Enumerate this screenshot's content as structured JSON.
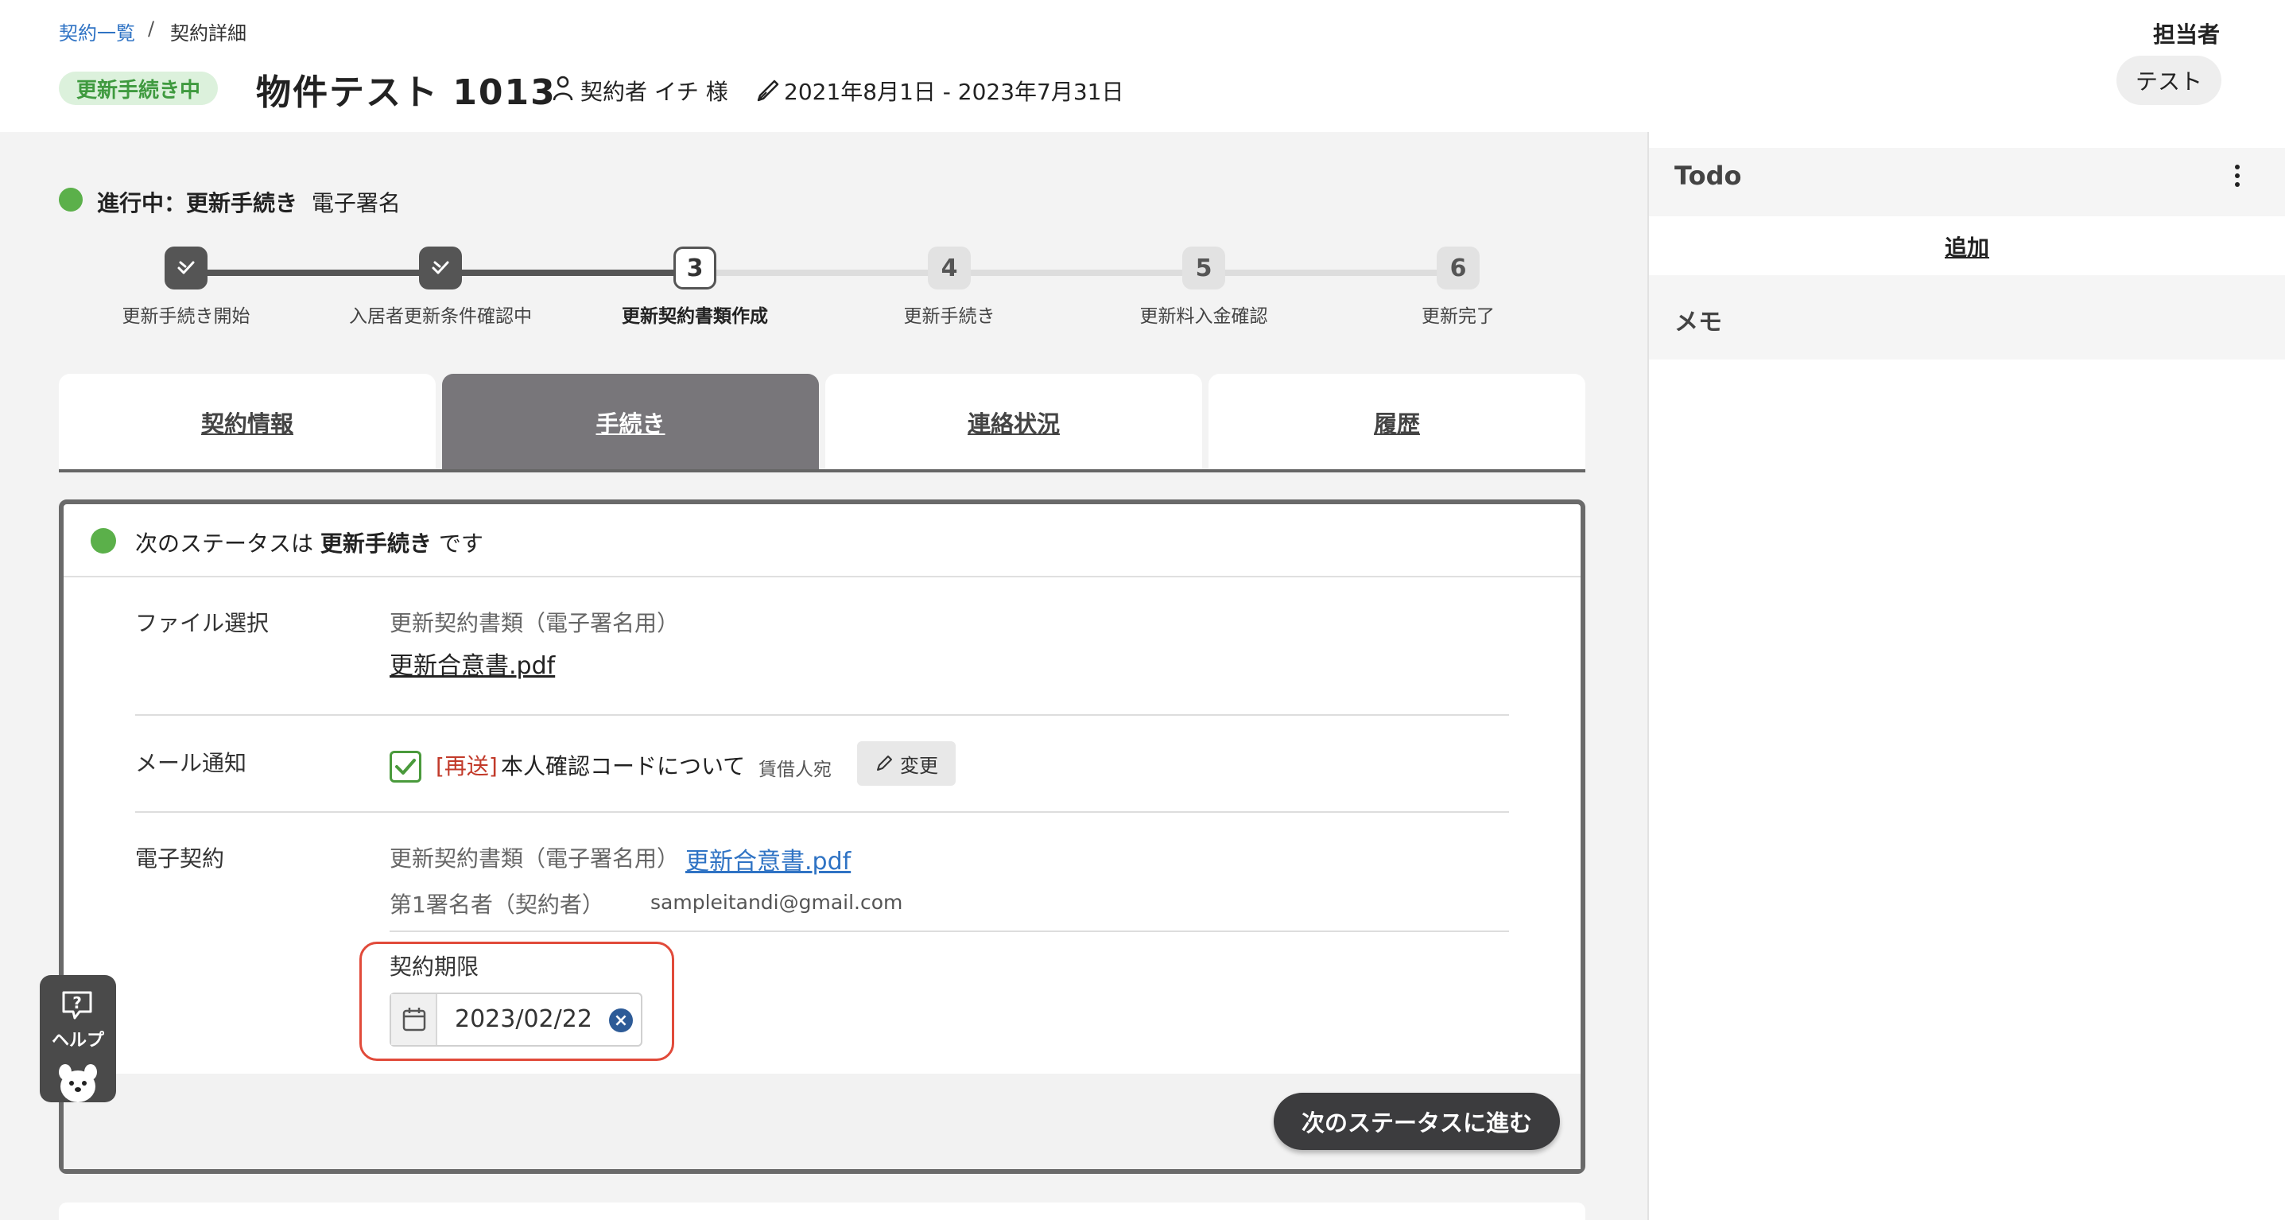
{
  "breadcrumb": {
    "parent": "契約一覧",
    "separator": "/",
    "current": "契約詳細"
  },
  "header": {
    "status_badge": "更新手続き中",
    "title": "物件テスト 1013",
    "contractor": "契約者 イチ 様",
    "period": "2021年8月1日 - 2023年7月31日",
    "assignee_label": "担当者",
    "assignee": "テスト"
  },
  "progress": {
    "prefix": "進行中：更新手続き",
    "detail": "電子署名",
    "status_color": "#5bb04a"
  },
  "steps": [
    {
      "num": "1",
      "label": "更新手続き開始",
      "state": "done"
    },
    {
      "num": "2",
      "label": "入居者更新条件確認中",
      "state": "done"
    },
    {
      "num": "3",
      "label": "更新契約書類作成",
      "state": "current"
    },
    {
      "num": "4",
      "label": "更新手続き",
      "state": "todo"
    },
    {
      "num": "5",
      "label": "更新料入金確認",
      "state": "todo"
    },
    {
      "num": "6",
      "label": "更新完了",
      "state": "todo"
    }
  ],
  "tabs": [
    {
      "label": "契約情報",
      "active": false
    },
    {
      "label": "手続き",
      "active": true
    },
    {
      "label": "連絡状況",
      "active": false
    },
    {
      "label": "履歴",
      "active": false
    }
  ],
  "card": {
    "next_status_prefix": "次のステータスは",
    "next_status_name": "更新手続き",
    "next_status_suffix": "です",
    "file_label": "ファイル選択",
    "file_type": "更新契約書類（電子署名用）",
    "file_name": "更新合意書.pdf",
    "mail_label": "メール通知",
    "mail_checked": true,
    "mail_resend": "[再送]",
    "mail_subject": "本人確認コードについて",
    "mail_recipient": "賃借人宛",
    "change_button": "変更",
    "esign_label": "電子契約",
    "esign_type": "更新契約書類（電子署名用）",
    "esign_file": "更新合意書.pdf",
    "signer_label": "第1署名者（契約者）",
    "signer_email": "sampleitandi@gmail.com",
    "deadline_label": "契約期限",
    "deadline_value": "2023/02/22",
    "next_button": "次のステータスに進む"
  },
  "sidebar": {
    "todo_title": "Todo",
    "todo_add": "追加",
    "memo_title": "メモ"
  },
  "help": {
    "label": "ヘルプ"
  },
  "icons": {
    "contractor": "person-icon",
    "period": "pen-icon",
    "kebab": "kebab-menu-icon",
    "calendar": "calendar-icon",
    "clear": "clear-icon",
    "edit": "pencil-icon",
    "step_done": "check-icon",
    "help": "question-bubble-icon"
  },
  "colors": {
    "accent_green": "#5bb04a",
    "link_blue": "#2f73c4",
    "highlight_red": "#e14a3a",
    "resend_red": "#c23a2a"
  }
}
